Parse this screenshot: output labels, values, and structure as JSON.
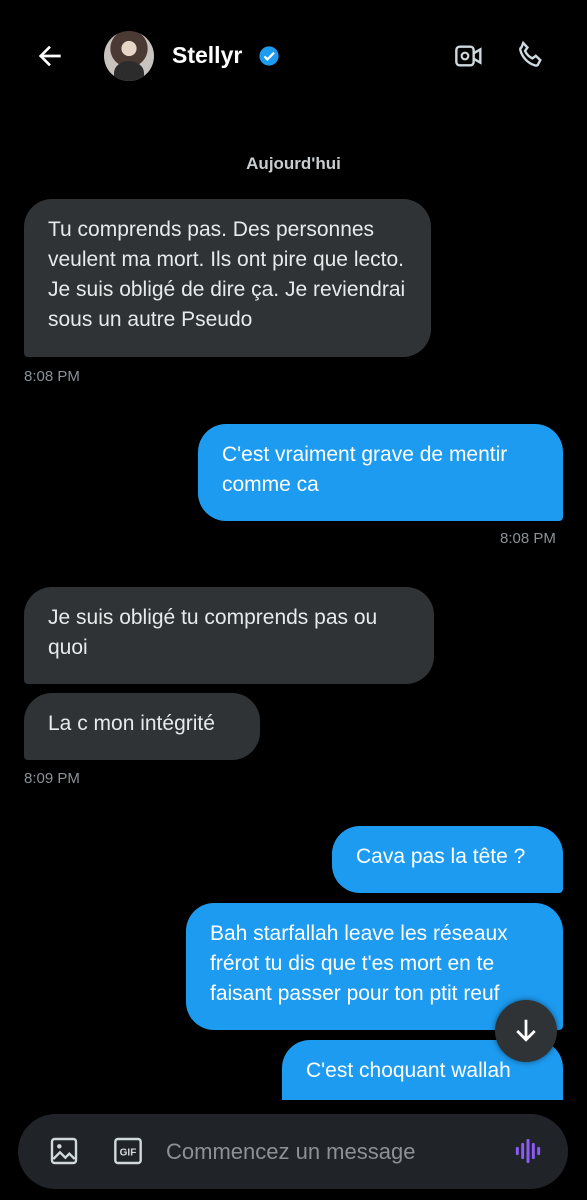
{
  "header": {
    "contact_name": "Stellyr",
    "icons": [
      "back-arrow-icon",
      "verified-badge-icon",
      "video-call-icon",
      "phone-call-icon"
    ]
  },
  "conversation": {
    "day_separator": "Aujourd'hui",
    "messages": [
      {
        "direction": "in",
        "text": "Tu comprends pas. Des personnes veulent ma mort. Ils ont pire que lecto. Je suis obligé de dire ça. Je reviendrai sous un autre Pseudo"
      },
      {
        "direction": "out",
        "text": "C'est vraiment grave de mentir comme ca"
      },
      {
        "direction": "in",
        "text": "Je suis obligé tu comprends pas ou quoi"
      },
      {
        "direction": "in",
        "text": "La c mon intégrité"
      },
      {
        "direction": "out",
        "text": "Cava pas la tête ?"
      },
      {
        "direction": "out",
        "text": "Bah starfallah leave les réseaux frérot tu dis que t'es mort en te faisant passer pour ton ptit reuf"
      },
      {
        "direction": "out",
        "text": "C'est choquant wallah"
      }
    ],
    "timestamps": [
      "8:08 PM",
      "8:08 PM",
      "8:09 PM"
    ]
  },
  "composer": {
    "placeholder": "Commencez un message",
    "icons": [
      "image-icon",
      "gif-icon",
      "voice-message-icon"
    ]
  },
  "colors": {
    "background": "#000000",
    "incoming_bubble": "#2f3336",
    "outgoing_bubble": "#1d9bf0",
    "verified": "#1d9bf0",
    "voice_accent": "#8b5cf6"
  }
}
